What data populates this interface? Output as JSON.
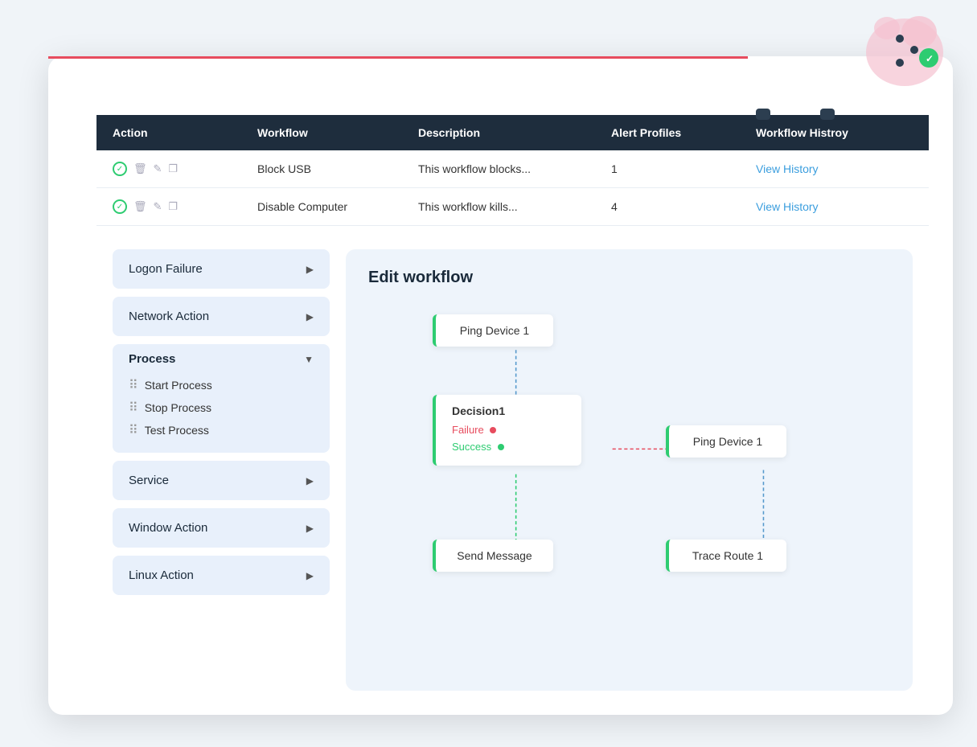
{
  "colors": {
    "header_bg": "#1e2d3d",
    "accent_red": "#e74c5e",
    "accent_green": "#2ecc71",
    "link_blue": "#3b9ede",
    "sidebar_bg": "#e8f0fb",
    "workflow_bg": "#eef4fb"
  },
  "table": {
    "columns": [
      "Action",
      "Workflow",
      "Description",
      "Alert Profiles",
      "Workflow Histroy"
    ],
    "rows": [
      {
        "workflow": "Block USB",
        "description": "This workflow blocks...",
        "alert_profiles": "1",
        "history_label": "View History"
      },
      {
        "workflow": "Disable Computer",
        "description": "This workflow kills...",
        "alert_profiles": "4",
        "history_label": "View History"
      }
    ]
  },
  "sidebar": {
    "items": [
      {
        "label": "Logon Failure",
        "expanded": false
      },
      {
        "label": "Network Action",
        "expanded": false
      },
      {
        "label": "Process",
        "expanded": true
      },
      {
        "label": "Service",
        "expanded": false
      },
      {
        "label": "Window Action",
        "expanded": false
      },
      {
        "label": "Linux Action",
        "expanded": false
      }
    ],
    "process_subitems": [
      "Start Process",
      "Stop Process",
      "Test Process"
    ]
  },
  "workflow_editor": {
    "title": "Edit workflow",
    "nodes": {
      "ping_device_1": "Ping Device 1",
      "decision1": "Decision1",
      "failure": "Failure",
      "success": "Success",
      "send_message": "Send Message",
      "ping_device_1b": "Ping Device 1",
      "trace_route_1": "Trace Route 1"
    }
  },
  "icons": {
    "check": "✓",
    "trash": "🗑",
    "edit": "✎",
    "copy": "⧉",
    "arrow_right": "▶",
    "arrow_down": "▼",
    "drag": "⠿"
  }
}
